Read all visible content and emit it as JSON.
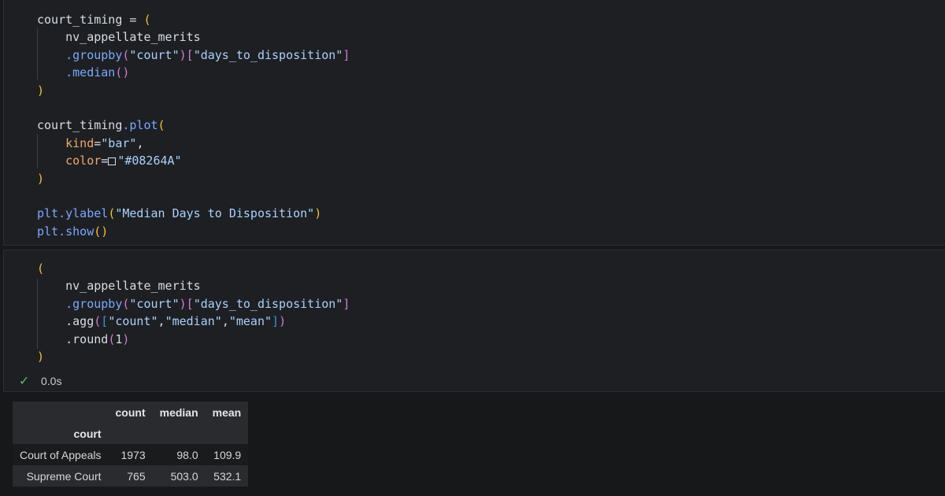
{
  "cells": [
    {
      "lines": [
        [
          [
            "court_timing = ",
            "var"
          ],
          [
            "(",
            "paren1"
          ]
        ],
        [
          [
            "    nv_appellate_merits",
            "var"
          ]
        ],
        [
          [
            "    ",
            "var"
          ],
          [
            ".groupby",
            "func"
          ],
          [
            "(",
            "paren2"
          ],
          [
            "\"court\"",
            "str"
          ],
          [
            ")",
            "paren2"
          ],
          [
            "[",
            "paren2"
          ],
          [
            "\"days_to_disposition\"",
            "str"
          ],
          [
            "]",
            "paren2"
          ]
        ],
        [
          [
            "    ",
            "var"
          ],
          [
            ".median",
            "func"
          ],
          [
            "()",
            "paren2"
          ]
        ],
        [
          [
            ")",
            "paren1"
          ]
        ],
        [
          [
            "",
            "var"
          ]
        ],
        [
          [
            "court_timing",
            "var"
          ],
          [
            ".plot",
            "func"
          ],
          [
            "(",
            "paren1"
          ]
        ],
        [
          [
            "    ",
            "var"
          ],
          [
            "kind",
            "kw"
          ],
          [
            "=",
            "op"
          ],
          [
            "\"bar\"",
            "str"
          ],
          [
            ",",
            "op"
          ]
        ],
        [
          [
            "    ",
            "var"
          ],
          [
            "color",
            "kw"
          ],
          [
            "=",
            "op"
          ],
          [
            "",
            "swatch"
          ],
          [
            "\"#08264A\"",
            "str"
          ]
        ],
        [
          [
            ")",
            "paren1"
          ]
        ],
        [
          [
            "",
            "var"
          ]
        ],
        [
          [
            "plt",
            "func"
          ],
          [
            ".ylabel",
            "func"
          ],
          [
            "(",
            "paren1"
          ],
          [
            "\"Median Days to Disposition\"",
            "str"
          ],
          [
            ")",
            "paren1"
          ]
        ],
        [
          [
            "plt",
            "func"
          ],
          [
            ".show",
            "func"
          ],
          [
            "()",
            "paren1"
          ]
        ]
      ]
    },
    {
      "lines": [
        [
          [
            "(",
            "paren1"
          ]
        ],
        [
          [
            "    nv_appellate_merits",
            "var"
          ]
        ],
        [
          [
            "    ",
            "var"
          ],
          [
            ".groupby",
            "func"
          ],
          [
            "(",
            "paren2"
          ],
          [
            "\"court\"",
            "str"
          ],
          [
            ")",
            "paren2"
          ],
          [
            "[",
            "paren2"
          ],
          [
            "\"days_to_disposition\"",
            "str"
          ],
          [
            "]",
            "paren2"
          ]
        ],
        [
          [
            "    .agg",
            "var"
          ],
          [
            "(",
            "paren2"
          ],
          [
            "[",
            "paren3"
          ],
          [
            "\"count\"",
            "str"
          ],
          [
            ",",
            "op"
          ],
          [
            "\"median\"",
            "str"
          ],
          [
            ",",
            "op"
          ],
          [
            "\"mean\"",
            "str"
          ],
          [
            "]",
            "paren3"
          ],
          [
            ")",
            "paren2"
          ]
        ],
        [
          [
            "    .round",
            "var"
          ],
          [
            "(",
            "paren2"
          ],
          [
            "1",
            "var"
          ],
          [
            ")",
            "paren2"
          ]
        ],
        [
          [
            ")",
            "paren1"
          ]
        ]
      ]
    }
  ],
  "status": {
    "check_icon": "check-icon",
    "duration": "0.0s"
  },
  "table": {
    "columns": [
      "count",
      "median",
      "mean"
    ],
    "index_name": "court",
    "rows": [
      {
        "index": "Court of Appeals",
        "values": [
          "1973",
          "98.0",
          "109.9"
        ]
      },
      {
        "index": "Supreme Court",
        "values": [
          "765",
          "503.0",
          "532.1"
        ]
      }
    ]
  }
}
